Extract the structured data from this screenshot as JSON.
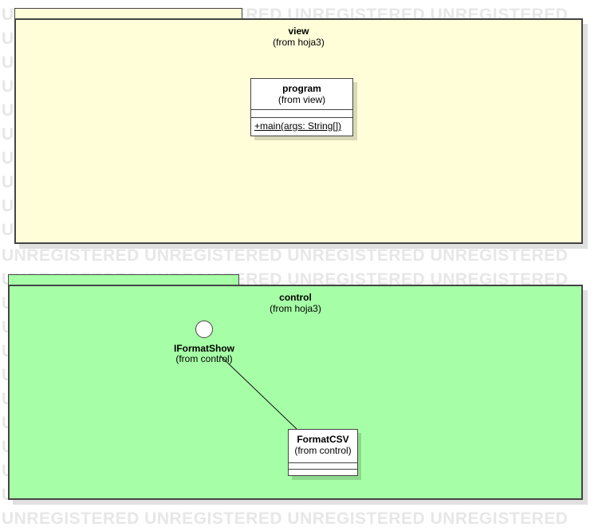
{
  "watermark": {
    "text": "UNREGISTERED UNREGISTERED UNREGISTERED UNREGISTERED"
  },
  "packages": {
    "view": {
      "name": "view",
      "from": "(from hoja3)",
      "fill": "#fffed9",
      "classes": {
        "program": {
          "name": "program",
          "from": "(from view)",
          "operation": "+main(args: String[])"
        }
      }
    },
    "control": {
      "name": "control",
      "from": "(from hoja3)",
      "fill": "#a6ffa6",
      "interface": {
        "name": "IFormatShow",
        "from": "(from control)"
      },
      "classes": {
        "formatcsv": {
          "name": "FormatCSV",
          "from": "(from control)"
        }
      }
    }
  },
  "colors": {
    "border": "#444444",
    "watermark": "#e7e7e7"
  }
}
